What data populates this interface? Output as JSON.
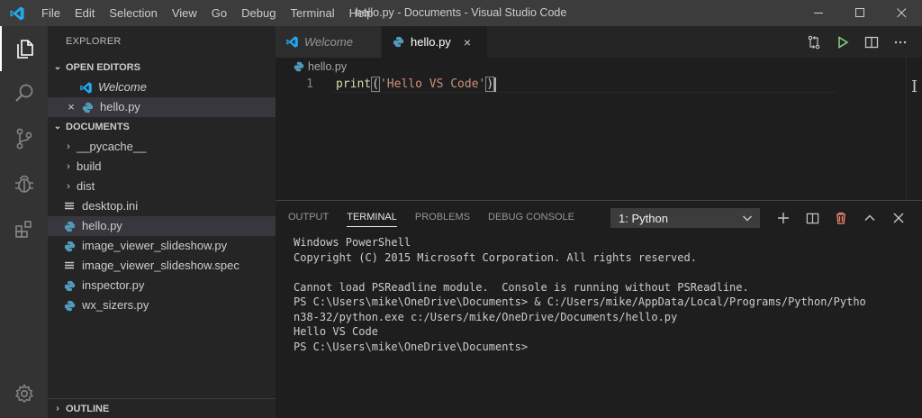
{
  "window": {
    "title": "hello.py - Documents - Visual Studio Code",
    "menu": [
      "File",
      "Edit",
      "Selection",
      "View",
      "Go",
      "Debug",
      "Terminal",
      "Help"
    ]
  },
  "sidebar": {
    "title": "EXPLORER",
    "open_editors": {
      "header": "OPEN EDITORS",
      "items": [
        {
          "label": "Welcome",
          "icon": "vscode-logo-icon"
        },
        {
          "label": "hello.py",
          "icon": "python-icon"
        }
      ]
    },
    "documents": {
      "header": "DOCUMENTS",
      "folders": [
        "__pycache__",
        "build",
        "dist"
      ],
      "files": [
        {
          "label": "desktop.ini",
          "icon": "text-file-icon"
        },
        {
          "label": "hello.py",
          "icon": "python-icon"
        },
        {
          "label": "image_viewer_slideshow.py",
          "icon": "python-icon"
        },
        {
          "label": "image_viewer_slideshow.spec",
          "icon": "text-file-icon"
        },
        {
          "label": "inspector.py",
          "icon": "python-icon"
        },
        {
          "label": "wx_sizers.py",
          "icon": "python-icon"
        }
      ]
    },
    "outline": {
      "header": "OUTLINE"
    }
  },
  "editor": {
    "tabs": [
      {
        "label": "Welcome"
      },
      {
        "label": "hello.py",
        "close": "×"
      }
    ],
    "breadcrumb": "hello.py",
    "lines": [
      {
        "number": "1",
        "fn": "print",
        "open": "(",
        "string": "'Hello VS Code'",
        "close": ")"
      }
    ],
    "overview_mark": "I"
  },
  "panel": {
    "tabs": [
      "OUTPUT",
      "TERMINAL",
      "PROBLEMS",
      "DEBUG CONSOLE"
    ],
    "active_tab": "TERMINAL",
    "terminal_selector": "1: Python",
    "terminal_lines": [
      "Windows PowerShell",
      "Copyright (C) 2015 Microsoft Corporation. All rights reserved.",
      "",
      "Cannot load PSReadline module.  Console is running without PSReadline.",
      "PS C:\\Users\\mike\\OneDrive\\Documents> & C:/Users/mike/AppData/Local/Programs/Python/Pytho",
      "n38-32/python.exe c:/Users/mike/OneDrive/Documents/hello.py",
      "Hello VS Code",
      "PS C:\\Users\\mike\\OneDrive\\Documents>"
    ]
  },
  "colors": {
    "accent_blue": "#23a9f2",
    "python_blue": "#519aba",
    "run_green": "#89d185",
    "trash_red": "#f48771"
  }
}
